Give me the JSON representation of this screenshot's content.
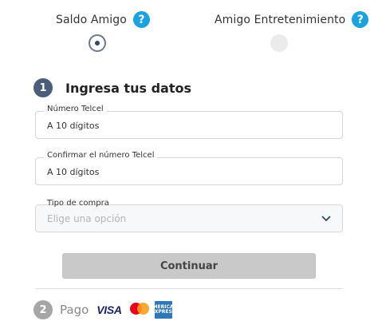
{
  "tabs": [
    {
      "label": "Saldo Amigo",
      "selected": true
    },
    {
      "label": "Amigo Entretenimiento",
      "selected": false
    }
  ],
  "help_glyph": "?",
  "step1": {
    "number": "1",
    "title": "Ingresa tus datos"
  },
  "fields": {
    "numero": {
      "label": "Número Telcel",
      "value": "A 10 dígitos"
    },
    "confirmar": {
      "label": "Confirmar el número Telcel",
      "value": "A 10 dígitos"
    },
    "tipo": {
      "label": "Tipo de compra",
      "placeholder": "Elige una opción"
    }
  },
  "continue_label": "Continuar",
  "step2": {
    "number": "2",
    "title": "Pago"
  },
  "cards": {
    "visa": "VISA",
    "amex": "AMERICAN EXPRESS"
  },
  "colors": {
    "help": "#1aa3e0",
    "step_active": "#4a5e7a",
    "step_inactive": "#a6a6a6",
    "button_bg": "#c9c9c9"
  }
}
